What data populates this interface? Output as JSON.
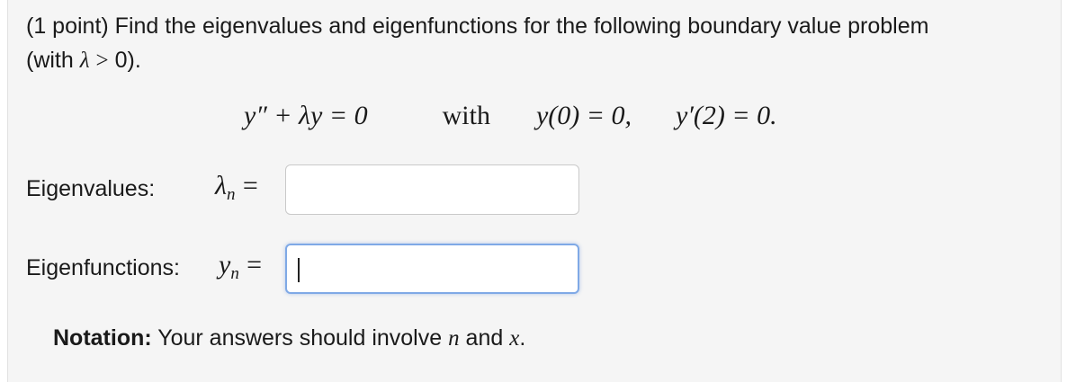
{
  "problem": {
    "points": "(1 point)",
    "text_1": "Find the eigenvalues and eigenfunctions for the following boundary value problem",
    "text_2_prefix": "(with",
    "lambda": "λ",
    "gt": ">",
    "zero_close": "0)."
  },
  "equation": {
    "ode": "y″ + λy = 0",
    "with": "with",
    "bc1": "y(0) = 0,",
    "bc2": "y′(2) = 0."
  },
  "eigenvalues": {
    "label": "Eigenvalues:",
    "symbol": "λ",
    "subscript": "n",
    "equals": "=",
    "value": ""
  },
  "eigenfunctions": {
    "label": "Eigenfunctions:",
    "symbol": "y",
    "subscript": "n",
    "equals": "=",
    "value": ""
  },
  "notation": {
    "label": "Notation:",
    "text": "Your answers should involve",
    "var1": "n",
    "and": "and",
    "var2": "x",
    "period": "."
  }
}
